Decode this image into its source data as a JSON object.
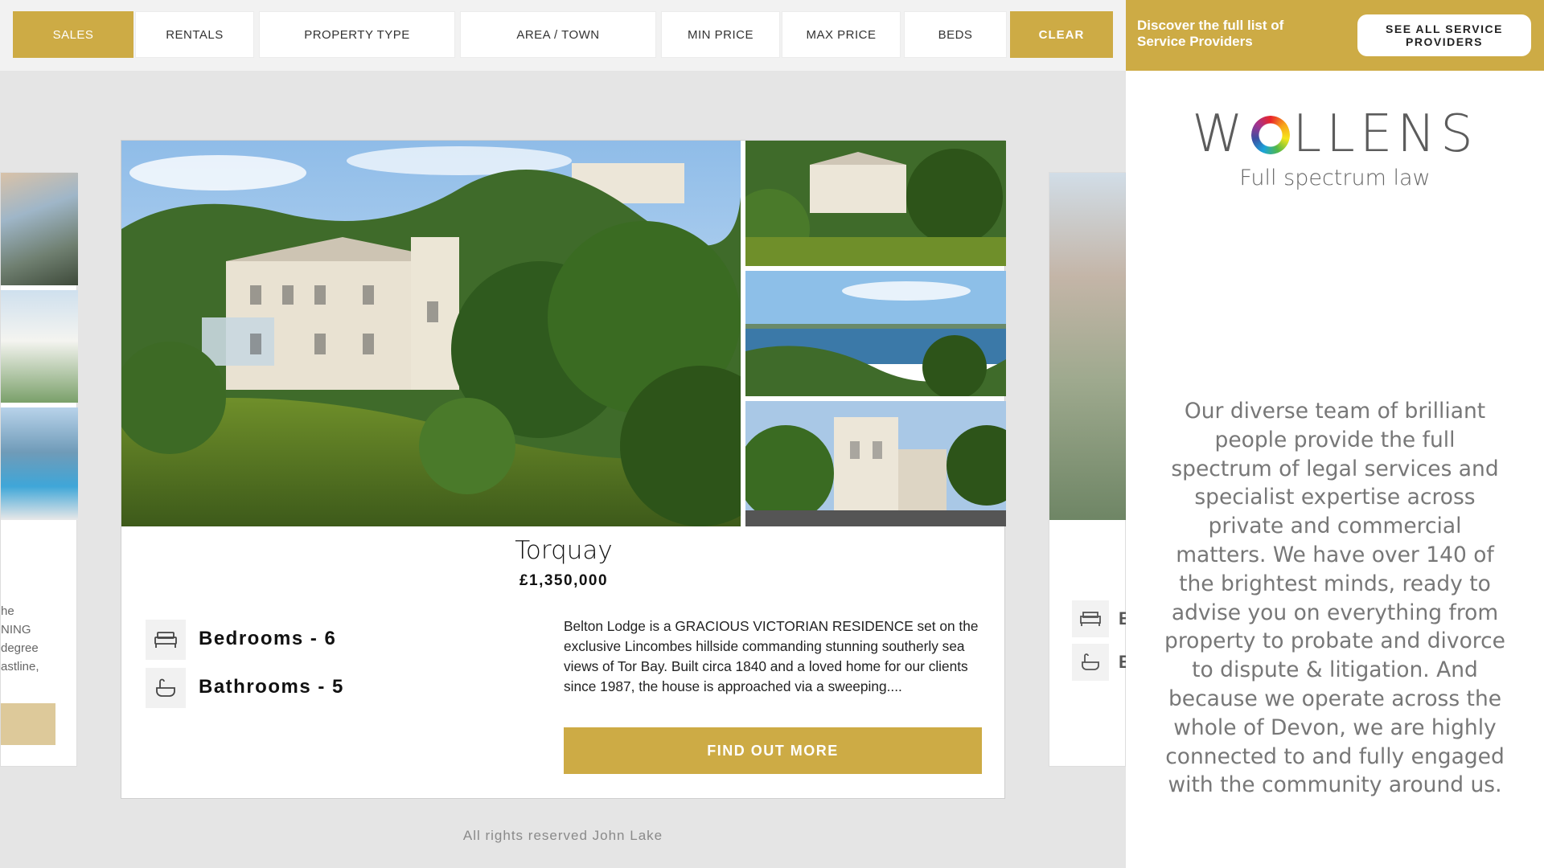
{
  "filters": {
    "sales": "SALES",
    "rentals": "RENTALS",
    "property_type": "PROPERTY TYPE",
    "area_town": "AREA / TOWN",
    "min_price": "MIN PRICE",
    "max_price": "MAX PRICE",
    "beds": "BEDS",
    "clear": "CLEAR"
  },
  "sidebar": {
    "discover_text": "Discover the full list of Service Providers",
    "see_all_button": "SEE ALL SERVICE PROVIDERS",
    "logo_word_before": "W",
    "logo_word_after": "LLENS",
    "logo_tagline": "Full spectrum law",
    "blurb": "Our diverse team of brilliant people provide the full spectrum of legal services and specialist expertise across private and commercial matters. We have over 140 of the brightest minds, ready to advise you on everything from property to probate and divorce to dispute & litigation. And because we operate across the whole of Devon, we are highly connected to and fully engaged with the community around us."
  },
  "left_card": {
    "text_lines": [
      "he",
      "NING",
      "degree",
      "astline,"
    ]
  },
  "right_card": {
    "letters": [
      "B",
      "B"
    ]
  },
  "listing": {
    "location": "Torquay",
    "price": "£1,350,000",
    "bedrooms_label": "Bedrooms - 6",
    "bathrooms_label": "Bathrooms - 5",
    "description": "Belton Lodge is a GRACIOUS VICTORIAN RESIDENCE set on the exclusive Lincombes hillside commanding stunning southerly sea views of Tor Bay. Built circa 1840 and a loved home for our clients since 1987, the house is approached via a sweeping....",
    "cta": "FIND OUT MORE"
  },
  "footer": {
    "text": "All rights reserved John Lake"
  },
  "colors": {
    "accent": "#cdab45",
    "background": "#e5e5e5"
  }
}
